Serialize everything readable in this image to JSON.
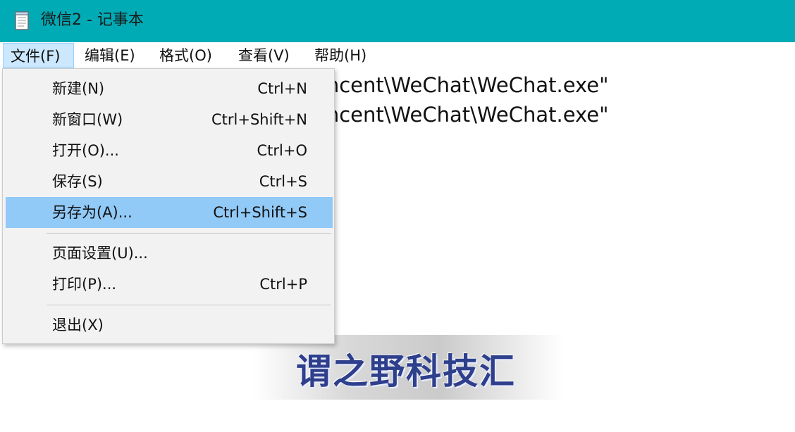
{
  "window": {
    "title": "微信2 - 记事本",
    "icon": "notepad-icon",
    "accent_color": "#00abb5"
  },
  "menubar": {
    "items": [
      {
        "label": "文件(F)",
        "active": true
      },
      {
        "label": "编辑(E)"
      },
      {
        "label": "格式(O)"
      },
      {
        "label": "查看(V)"
      },
      {
        "label": "帮助(H)"
      }
    ]
  },
  "document": {
    "lines": [
      "encent\\WeChat\\WeChat.exe\"",
      "encent\\WeChat\\WeChat.exe\""
    ]
  },
  "file_menu": {
    "items": [
      {
        "label": "新建(N)",
        "shortcut": "Ctrl+N"
      },
      {
        "label": "新窗口(W)",
        "shortcut": "Ctrl+Shift+N"
      },
      {
        "label": "打开(O)...",
        "shortcut": "Ctrl+O"
      },
      {
        "label": "保存(S)",
        "shortcut": "Ctrl+S"
      },
      {
        "label": "另存为(A)...",
        "shortcut": "Ctrl+Shift+S",
        "highlighted": true
      },
      {
        "label": "页面设置(U)...",
        "shortcut": ""
      },
      {
        "label": "打印(P)...",
        "shortcut": "Ctrl+P"
      },
      {
        "label": "退出(X)",
        "shortcut": ""
      }
    ],
    "highlight_color": "#91c9f7"
  },
  "watermark": {
    "text": "谓之野科技汇"
  }
}
